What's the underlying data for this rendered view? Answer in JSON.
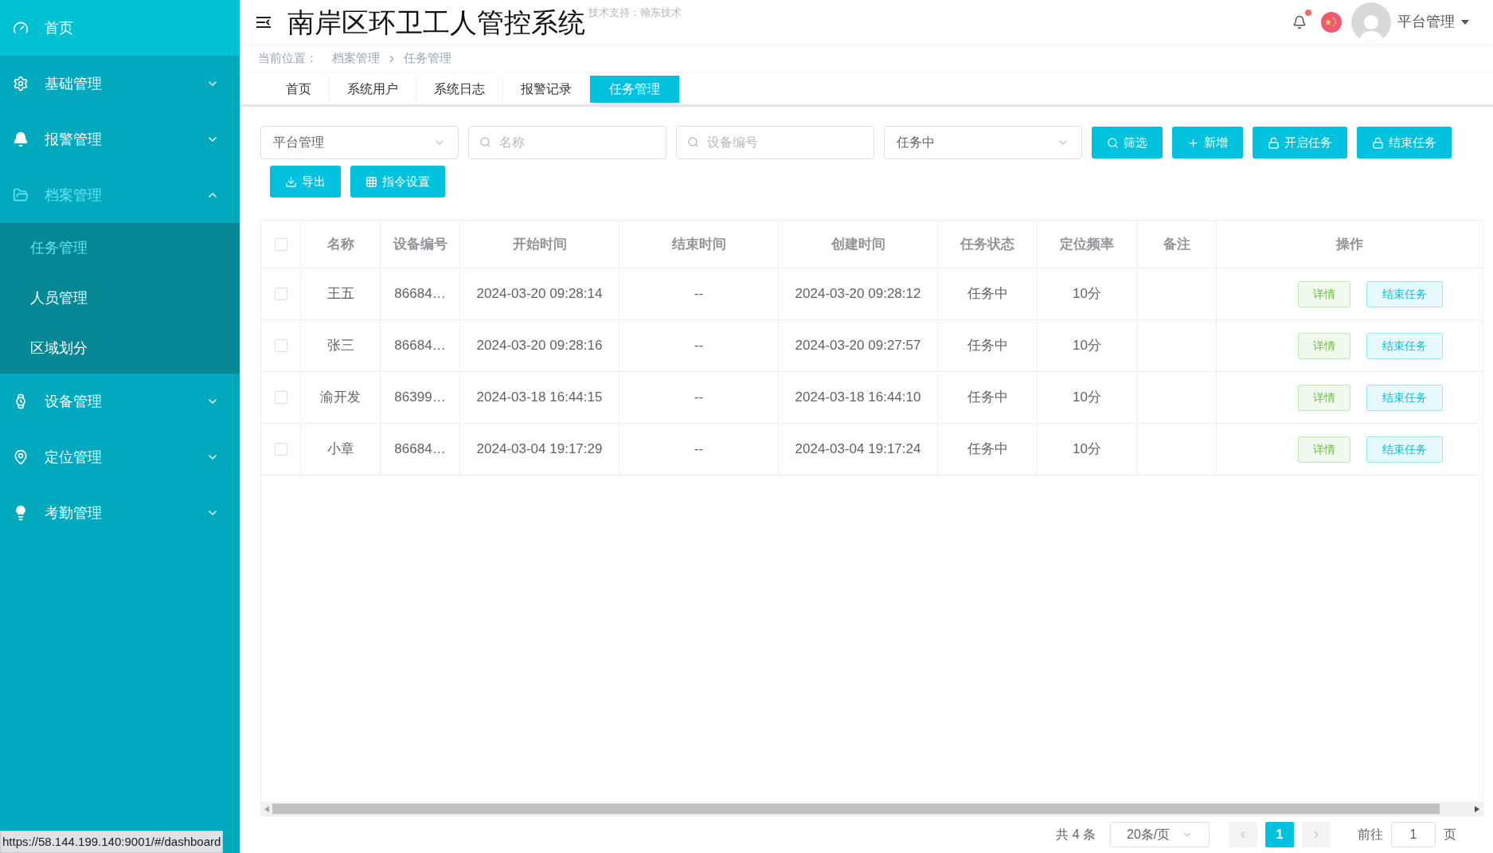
{
  "sidebar": {
    "items": [
      {
        "kind": "link",
        "label": "首页"
      },
      {
        "kind": "group",
        "label": "基础管理",
        "expanded": false
      },
      {
        "kind": "group",
        "label": "报警管理",
        "expanded": false
      },
      {
        "kind": "group",
        "label": "档案管理",
        "expanded": true,
        "children": [
          {
            "label": "任务管理",
            "selected": true
          },
          {
            "label": "人员管理",
            "selected": false
          },
          {
            "label": "区域划分",
            "selected": false
          }
        ]
      },
      {
        "kind": "group",
        "label": "设备管理",
        "expanded": false
      },
      {
        "kind": "group",
        "label": "定位管理",
        "expanded": false
      },
      {
        "kind": "group",
        "label": "考勤管理",
        "expanded": false
      }
    ]
  },
  "header": {
    "title": "南岸区环卫工人管控系统",
    "subtitle": "技术支持：翰东技术",
    "notifications_unread": true,
    "user": "平台管理"
  },
  "breadcrumb": {
    "label": "当前位置：",
    "items": [
      "档案管理",
      "任务管理"
    ]
  },
  "tabs": [
    {
      "label": "首页",
      "selected": false
    },
    {
      "label": "系统用户",
      "selected": false
    },
    {
      "label": "系统日志",
      "selected": false
    },
    {
      "label": "报警记录",
      "selected": false
    },
    {
      "label": "任务管理",
      "selected": true
    }
  ],
  "filters": [
    {
      "kind": "select",
      "value": "平台管理"
    },
    {
      "kind": "input",
      "placeholder": "名称"
    },
    {
      "kind": "input",
      "placeholder": "设备编号"
    },
    {
      "kind": "select",
      "value": "任务中"
    }
  ],
  "buttons": [
    {
      "label": "筛选"
    },
    {
      "label": "新增"
    },
    {
      "label": "开启任务"
    },
    {
      "label": "结束任务"
    },
    {
      "label": "导出"
    },
    {
      "label": "指令设置"
    }
  ],
  "table": {
    "columns": [
      "名称",
      "设备编号",
      "开始时间",
      "结束时间",
      "创建时间",
      "任务状态",
      "定位频率",
      "备注",
      "操作"
    ],
    "all_selected": false,
    "rows": [
      {
        "selected": false,
        "cells": [
          "王五",
          "86684…",
          "2024-03-20 09:28:14",
          "--",
          "2024-03-20 09:28:12",
          "任务中",
          "10分",
          ""
        ],
        "actions": [
          "详情",
          "结束任务"
        ]
      },
      {
        "selected": false,
        "cells": [
          "张三",
          "86684…",
          "2024-03-20 09:28:16",
          "--",
          "2024-03-20 09:27:57",
          "任务中",
          "10分",
          ""
        ],
        "actions": [
          "详情",
          "结束任务"
        ]
      },
      {
        "selected": false,
        "cells": [
          "渝开发",
          "86399…",
          "2024-03-18 16:44:15",
          "--",
          "2024-03-18 16:44:10",
          "任务中",
          "10分",
          ""
        ],
        "actions": [
          "详情",
          "结束任务"
        ]
      },
      {
        "selected": false,
        "cells": [
          "小章",
          "86684…",
          "2024-03-04 19:17:29",
          "--",
          "2024-03-04 19:17:24",
          "任务中",
          "10分",
          ""
        ],
        "actions": [
          "详情",
          "结束任务"
        ]
      }
    ]
  },
  "pagination": {
    "total": "共 4 条",
    "page_size": "20条/页",
    "pages": [
      {
        "label": "1",
        "selected": true
      }
    ],
    "goto_label": "前往",
    "goto_value": "1",
    "goto_suffix": "页"
  },
  "status_url": "https://58.144.199.140:9001/#/dashboard"
}
